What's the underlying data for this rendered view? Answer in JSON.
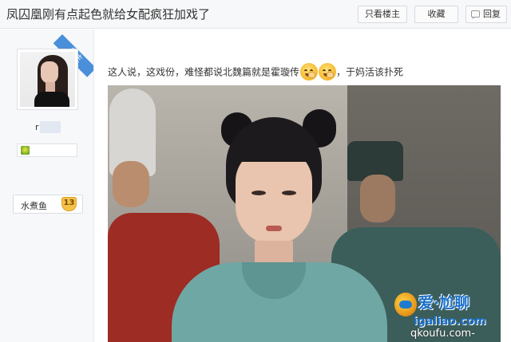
{
  "title_bar": {
    "title": "凤囚凰刚有点起色就给女配疯狂加戏了",
    "only_op_label": "只看楼主",
    "favorite_label": "收藏",
    "reply_label": "回复"
  },
  "author": {
    "badge": "楼主",
    "username": "r",
    "tag_label": "水煮鱼",
    "tag_level": "13"
  },
  "post": {
    "text_before": "这人说，这戏份，难怪都说北魏篇就是霍璇传",
    "text_after": "，于妈活该扑死",
    "emojis": [
      "laughing-crying-emoji",
      "laughing-crying-emoji"
    ]
  },
  "watermark": {
    "main": "爱·尬聊",
    "site": "igaliao.com",
    "url": "qkoufu.com-"
  },
  "colors": {
    "header_bg": "#f7f8fa",
    "badge_blue": "#4a8fd9",
    "level_gold": "#f4c24a",
    "watermark_blue": "#1a6fc8"
  }
}
